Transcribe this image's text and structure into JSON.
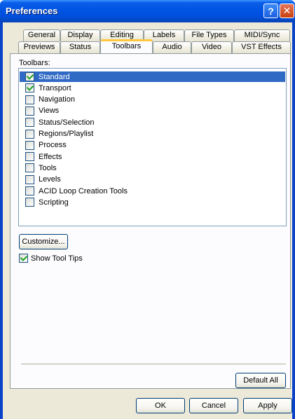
{
  "window": {
    "title": "Preferences",
    "help_glyph": "?",
    "close_glyph": "✕"
  },
  "tabs": {
    "row_back": [
      "General",
      "Display",
      "Editing",
      "Labels",
      "File Types",
      "MIDI/Sync"
    ],
    "row_front": [
      "Previews",
      "Status",
      "Toolbars",
      "Audio",
      "Video",
      "VST Effects"
    ],
    "active": "Toolbars"
  },
  "toolbars": {
    "label": "Toolbars:",
    "items": [
      {
        "label": "Standard",
        "checked": true,
        "selected": true
      },
      {
        "label": "Transport",
        "checked": true,
        "selected": false
      },
      {
        "label": "Navigation",
        "checked": false,
        "selected": false
      },
      {
        "label": "Views",
        "checked": false,
        "selected": false
      },
      {
        "label": "Status/Selection",
        "checked": false,
        "selected": false
      },
      {
        "label": "Regions/Playlist",
        "checked": false,
        "selected": false
      },
      {
        "label": "Process",
        "checked": false,
        "selected": false
      },
      {
        "label": "Effects",
        "checked": false,
        "selected": false
      },
      {
        "label": "Tools",
        "checked": false,
        "selected": false
      },
      {
        "label": "Levels",
        "checked": false,
        "selected": false
      },
      {
        "label": "ACID Loop Creation Tools",
        "checked": false,
        "selected": false
      },
      {
        "label": "Scripting",
        "checked": false,
        "selected": false
      }
    ]
  },
  "customize_label": "Customize...",
  "show_tool_tips": {
    "label": "Show Tool Tips",
    "checked": true
  },
  "buttons": {
    "default_all": "Default All",
    "ok": "OK",
    "cancel": "Cancel",
    "apply": "Apply"
  }
}
